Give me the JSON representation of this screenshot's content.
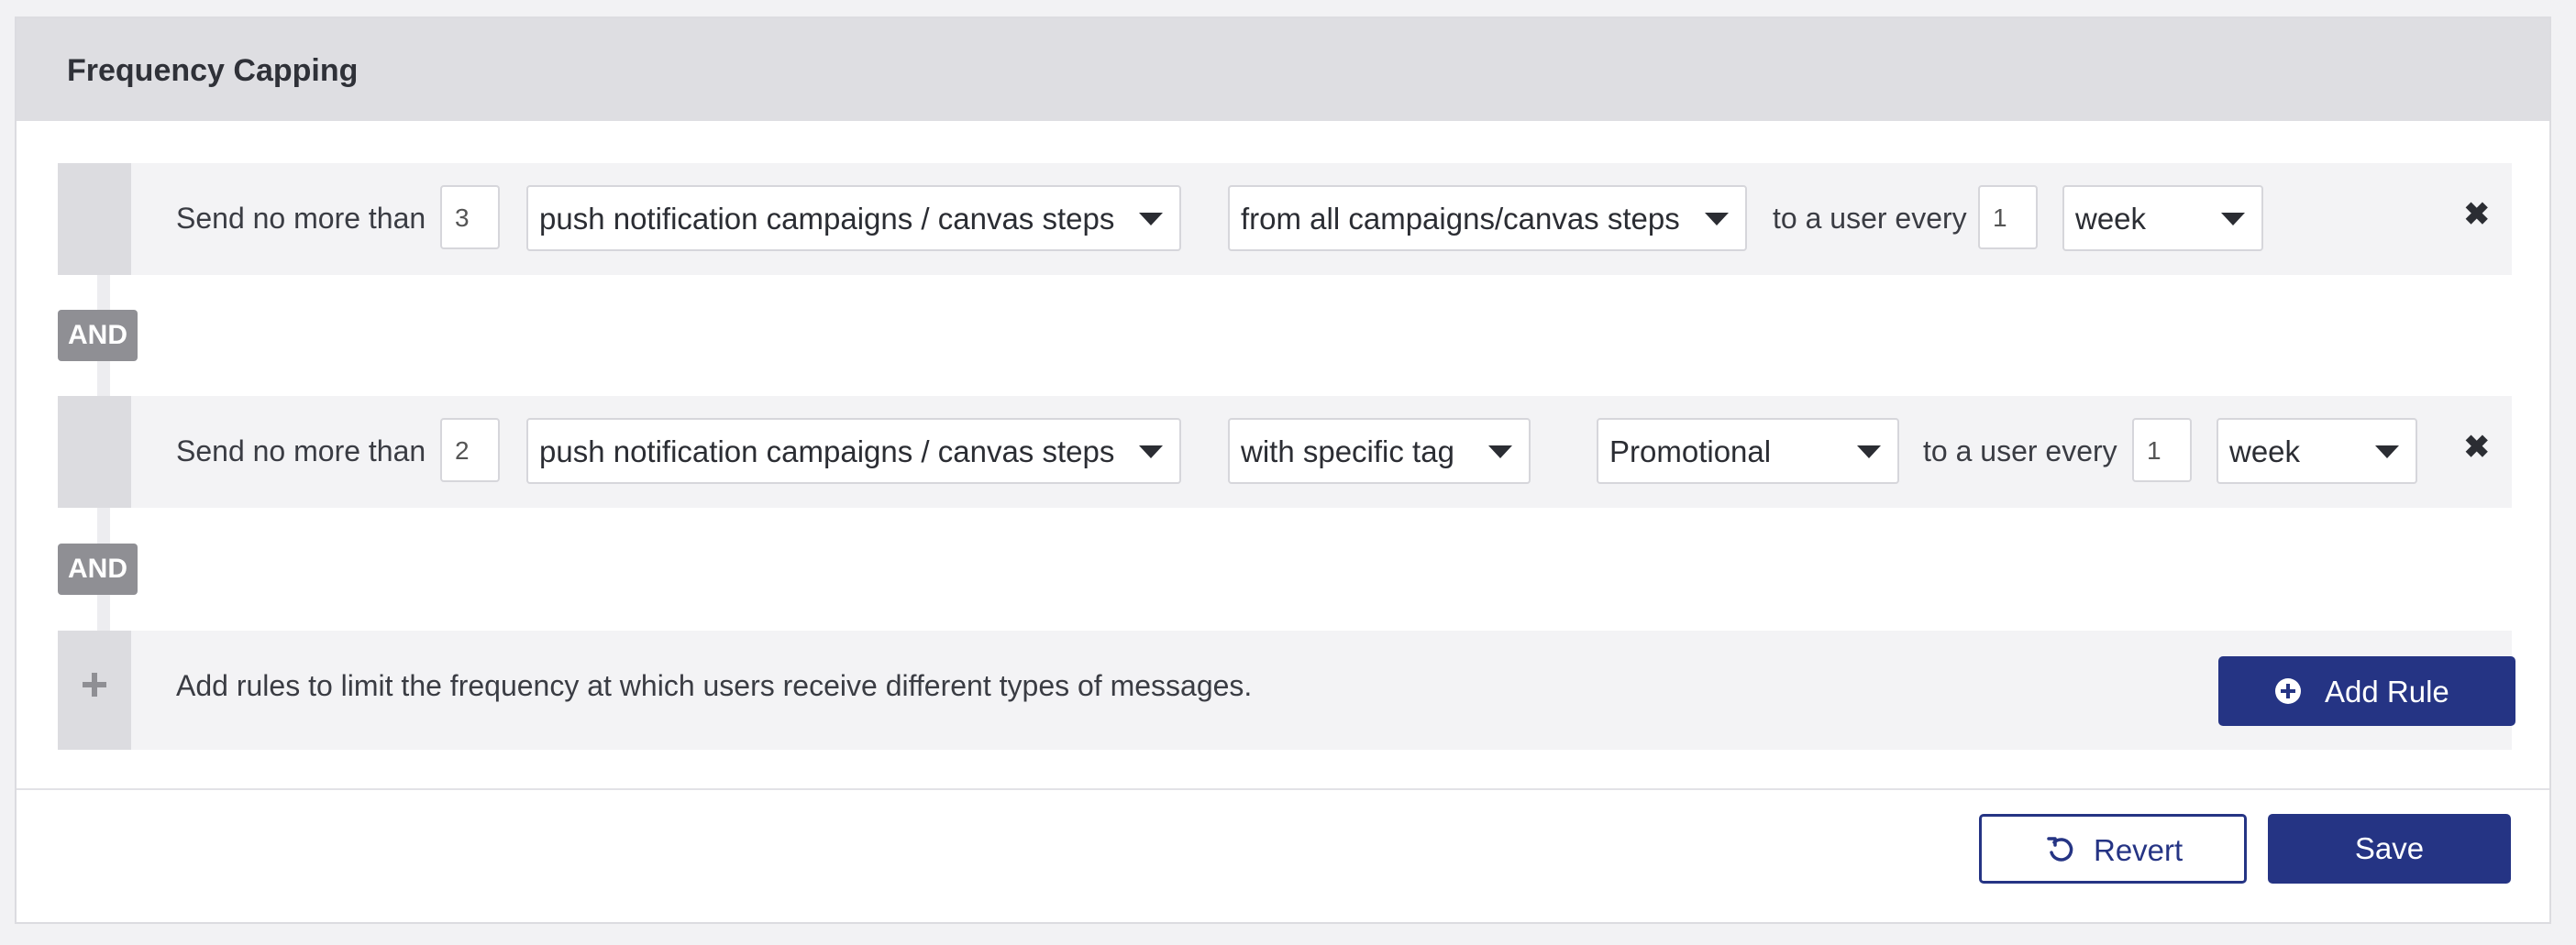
{
  "header": {
    "title": "Frequency Capping"
  },
  "rules": [
    {
      "prefix": "Send no more than",
      "count": "3",
      "message_type": "push notification campaigns / canvas steps",
      "source": "from all campaigns/canvas steps",
      "middle_text": "to a user every",
      "interval": "1",
      "period": "week",
      "remove_icon": "✖"
    },
    {
      "prefix": "Send no more than",
      "count": "2",
      "message_type": "push notification campaigns / canvas steps",
      "source": "with specific tag",
      "tag": "Promotional",
      "middle_text": "to a user every",
      "interval": "1",
      "period": "week",
      "remove_icon": "✖"
    }
  ],
  "connector_label": "AND",
  "add_rule": {
    "description": "Add rules to limit the frequency at which users receive different types of messages.",
    "button_label": "Add Rule",
    "icon": "plus-circle-icon"
  },
  "footer": {
    "revert_label": "Revert",
    "revert_icon": "undo-icon",
    "save_label": "Save"
  },
  "colors": {
    "primary": "#253484",
    "header_bg": "#dedee2",
    "and_badge": "#8f8f94"
  }
}
